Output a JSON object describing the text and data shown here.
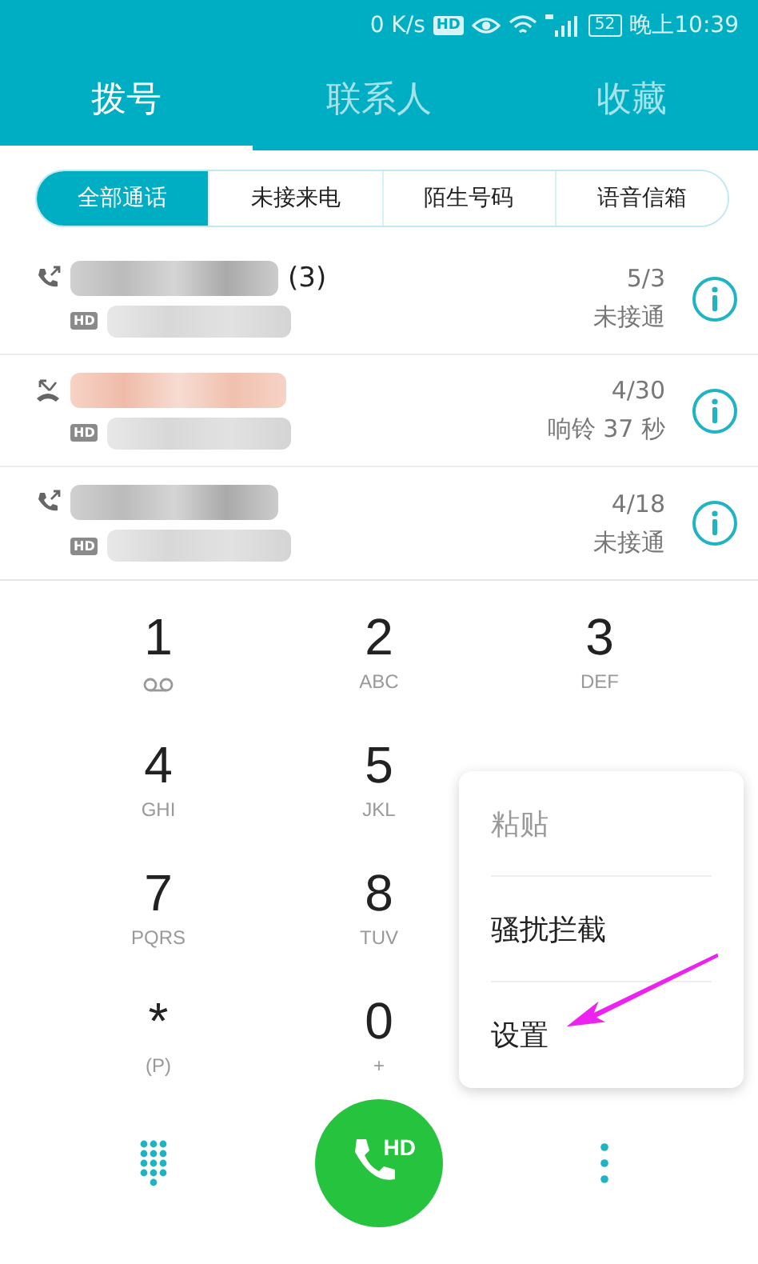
{
  "status_bar": {
    "speed": "0 K/s",
    "hd": "HD",
    "battery": "52",
    "time": "晚上10:39"
  },
  "tabs": [
    {
      "label": "拨号",
      "selected": true
    },
    {
      "label": "联系人",
      "selected": false
    },
    {
      "label": "收藏",
      "selected": false
    }
  ],
  "filters": [
    {
      "label": "全部通话",
      "selected": true
    },
    {
      "label": "未接来电",
      "selected": false
    },
    {
      "label": "陌生号码",
      "selected": false
    },
    {
      "label": "语音信箱",
      "selected": false
    }
  ],
  "calls": [
    {
      "kind": "outgoing",
      "count": "(3)",
      "hd": "HD",
      "date": "5/3",
      "status": "未接通"
    },
    {
      "kind": "rejected",
      "hd": "HD",
      "date": "4/30",
      "status": "响铃 37 秒"
    },
    {
      "kind": "outgoing",
      "hd": "HD",
      "date": "4/18",
      "status": "未接通"
    }
  ],
  "keys": [
    {
      "digit": "1",
      "kind": "voicemail"
    },
    {
      "digit": "2",
      "letters": "ABC"
    },
    {
      "digit": "3",
      "letters": "DEF"
    },
    {
      "digit": "4",
      "letters": "GHI"
    },
    {
      "digit": "5",
      "letters": "JKL"
    },
    {
      "digit": "7",
      "letters": "PQRS"
    },
    {
      "digit": "8",
      "letters": "TUV"
    },
    {
      "digit": "*",
      "letters": "(P)"
    },
    {
      "digit": "0",
      "letters": "+"
    }
  ],
  "call_button": {
    "label": "HD"
  },
  "menu": [
    {
      "label": "粘贴",
      "disabled": true
    },
    {
      "label": "骚扰拦截",
      "disabled": false
    },
    {
      "label": "设置",
      "disabled": false
    }
  ]
}
